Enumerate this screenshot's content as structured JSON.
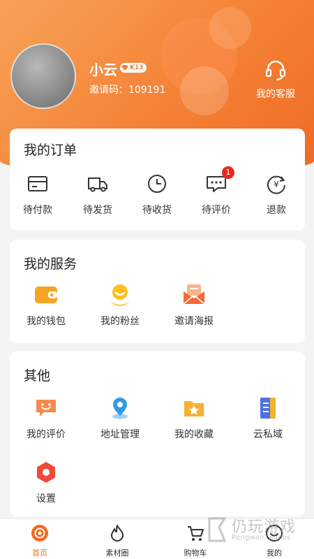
{
  "header": {
    "username": "小云",
    "level": "K13",
    "invite_code": "邀请码：109191",
    "service_label": "我的客服"
  },
  "orders": {
    "title": "我的订单",
    "items": [
      {
        "label": "待付款",
        "icon": "card-icon"
      },
      {
        "label": "待发货",
        "icon": "truck-icon"
      },
      {
        "label": "待收货",
        "icon": "clock-icon"
      },
      {
        "label": "待评价",
        "icon": "chat-icon",
        "badge": "1"
      },
      {
        "label": "退款",
        "icon": "refund-icon"
      }
    ]
  },
  "services": {
    "title": "我的服务",
    "items": [
      {
        "label": "我的钱包",
        "icon": "wallet-icon"
      },
      {
        "label": "我的粉丝",
        "icon": "fans-icon"
      },
      {
        "label": "邀请海报",
        "icon": "mail-icon"
      }
    ]
  },
  "other": {
    "title": "其他",
    "items": [
      {
        "label": "我的评价",
        "icon": "smile-chat-icon"
      },
      {
        "label": "地址管理",
        "icon": "location-icon"
      },
      {
        "label": "我的收藏",
        "icon": "star-folder-icon"
      },
      {
        "label": "云私域",
        "icon": "document-icon"
      },
      {
        "label": "设置",
        "icon": "gear-hex-icon"
      }
    ]
  },
  "tabbar": {
    "tabs": [
      {
        "label": "首页",
        "icon": "home-icon",
        "active": true
      },
      {
        "label": "素材圈",
        "icon": "flame-icon",
        "active": false
      },
      {
        "label": "购物车",
        "icon": "cart-icon",
        "active": false
      },
      {
        "label": "我的",
        "icon": "smile-icon",
        "active": false
      }
    ]
  },
  "watermark": {
    "cn": "仍玩游戏",
    "en": "Rengwan Games"
  },
  "colors": {
    "accent": "#f48236",
    "active_tab": "#f26a21",
    "badge": "#e8281e"
  }
}
